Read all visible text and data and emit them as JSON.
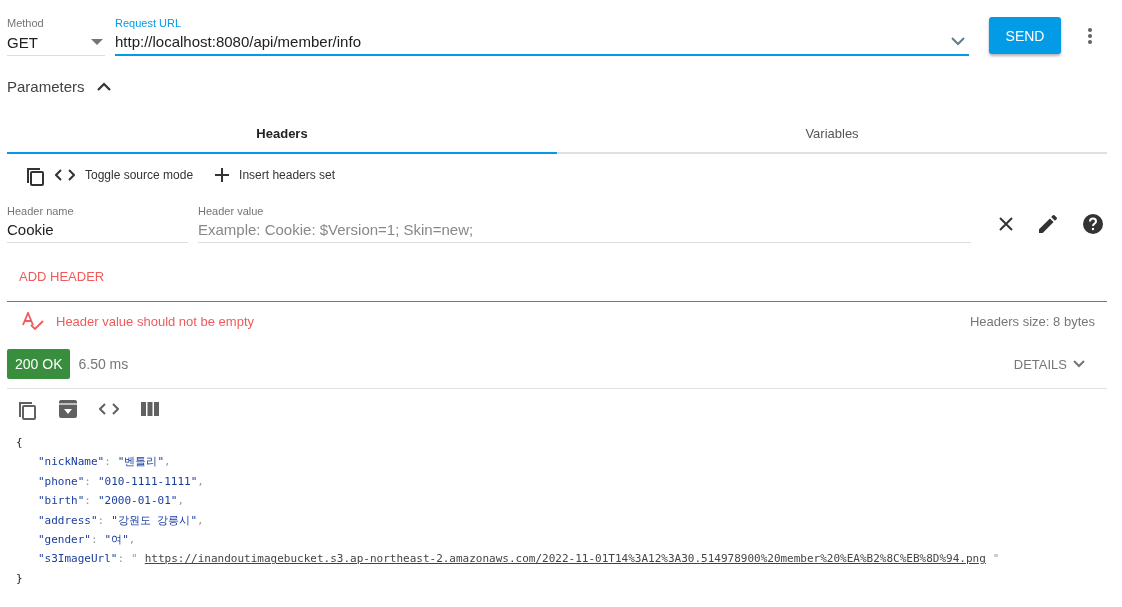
{
  "request": {
    "method_label": "Method",
    "method": "GET",
    "url_label": "Request URL",
    "url": "http://localhost:8080/api/member/info",
    "send": "SEND"
  },
  "parameters": {
    "title": "Parameters",
    "expanded": true
  },
  "tabs": [
    {
      "label": "Headers",
      "selected": true
    },
    {
      "label": "Variables",
      "selected": false
    }
  ],
  "toolbar": [
    "Toggle source mode",
    "Insert headers set"
  ],
  "header_row": {
    "name_label": "Header name",
    "name": "Cookie",
    "value_label": "Header value",
    "value_placeholder": "Example: Cookie: $Version=1; Skin=new;"
  },
  "add_header": "ADD HEADER",
  "validation": {
    "error": "Header value should not be empty",
    "size": "Headers size: 8 bytes"
  },
  "response": {
    "status": "200 OK",
    "time": "6.50 ms",
    "details": "DETAILS",
    "open_brace": "{",
    "close_brace": "}",
    "fields": [
      {
        "key": "\"nickName\"",
        "colon": ":",
        "value": "\"벤틀리\"",
        "comma": ",",
        "kind": "string"
      },
      {
        "key": "\"phone\"",
        "colon": ":",
        "value": "\"010-1111-1111\"",
        "comma": ",",
        "kind": "string"
      },
      {
        "key": "\"birth\"",
        "colon": ":",
        "value": "\"2000-01-01\"",
        "comma": ",",
        "kind": "string"
      },
      {
        "key": "\"address\"",
        "colon": ":",
        "value": "\"강원도 강릉시\"",
        "comma": ",",
        "kind": "string"
      },
      {
        "key": "\"gender\"",
        "colon": ":",
        "value": "\"여\"",
        "comma": ",",
        "kind": "string"
      },
      {
        "key": "\"s3ImageUrl\"",
        "colon": ":",
        "quote_open": "\"",
        "value": "https://inandoutimagebucket.s3.ap-northeast-2.amazonaws.com/2022-11-01T14%3A12%3A30.514978900%20member%20%EA%B2%8C%EB%8D%94.png",
        "quote_close": "\"",
        "kind": "link"
      }
    ]
  }
}
